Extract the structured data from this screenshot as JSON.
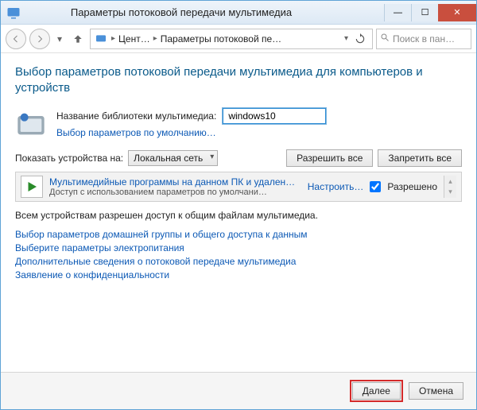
{
  "window": {
    "title": "Параметры потоковой передачи мультимедиа"
  },
  "nav": {
    "breadcrumb": {
      "seg1": "Цент…",
      "seg2": "Параметры потоковой пе…"
    },
    "search_placeholder": "Поиск в пан…"
  },
  "heading": "Выбор параметров потоковой передачи мультимедиа для компьютеров и устройств",
  "library": {
    "label": "Название библиотеки мультимедиа:",
    "value": "windows10",
    "defaults_link": "Выбор параметров по умолчанию…"
  },
  "show": {
    "label": "Показать устройства на:",
    "selected": "Локальная сеть",
    "allow_all": "Разрешить все",
    "block_all": "Запретить все"
  },
  "device": {
    "title": "Мультимедийные программы на данном ПК и удален…",
    "subtitle": "Доступ с использованием параметров по умолчани…",
    "customize": "Настроить…",
    "allowed_label": "Разрешено",
    "allowed_checked": true
  },
  "summary": "Всем устройствам разрешен доступ к общим файлам мультимедиа.",
  "links": {
    "homegroup": "Выбор параметров домашней группы и общего доступа к данным",
    "power": "Выберите параметры электропитания",
    "more": "Дополнительные сведения о потоковой передаче мультимедиа",
    "privacy": "Заявление о конфиденциальности"
  },
  "footer": {
    "next": "Далее",
    "cancel": "Отмена"
  }
}
